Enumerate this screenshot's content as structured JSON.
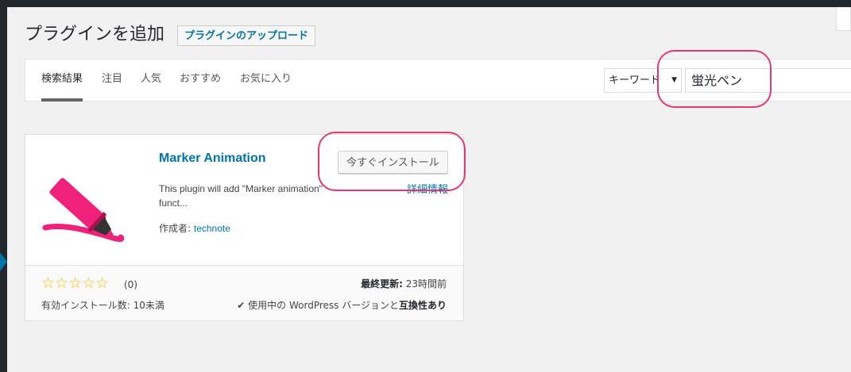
{
  "header": {
    "title": "プラグインを追加",
    "upload_button": "プラグインのアップロード"
  },
  "tabs": [
    {
      "label": "検索結果",
      "current": true
    },
    {
      "label": "注目"
    },
    {
      "label": "人気"
    },
    {
      "label": "おすすめ"
    },
    {
      "label": "お気に入り"
    }
  ],
  "search": {
    "type_selected": "キーワード",
    "query": "蛍光ペン"
  },
  "plugin": {
    "name": "Marker Animation",
    "install_label": "今すぐインストール",
    "details_label": "詳細情報",
    "description": "This plugin will add \"Marker animation\" funct...",
    "author_prefix": "作成者: ",
    "author": "technote",
    "rating_count": "(0)",
    "rating_value": 0,
    "installs": "有効インストール数: 10未満",
    "last_updated_label": "最終更新:",
    "last_updated": "23時間前",
    "compat_prefix": "使用中の WordPress バージョンと",
    "compat_status": "互換性あり",
    "icon": "highlighter-marker-icon"
  },
  "colors": {
    "accent": "#0073aa",
    "annotation": "#e8376f",
    "marker": "#f0217a"
  }
}
